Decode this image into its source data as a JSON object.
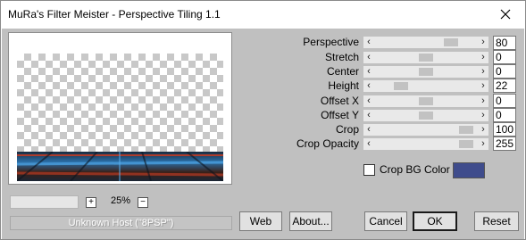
{
  "window": {
    "title": "MuRa's Filter Meister - Perspective Tiling 1.1"
  },
  "zoom": {
    "plus": "+",
    "minus": "−",
    "value": "25%"
  },
  "status": {
    "host": "Unknown Host (\"8PSP\")",
    "progress_percent": 0
  },
  "params": [
    {
      "label": "Perspective",
      "value": "80",
      "position_fraction": 0.78
    },
    {
      "label": "Stretch",
      "value": "0",
      "position_fraction": 0.5
    },
    {
      "label": "Center",
      "value": "0",
      "position_fraction": 0.5
    },
    {
      "label": "Height",
      "value": "22",
      "position_fraction": 0.22
    },
    {
      "label": "Offset X",
      "value": "0",
      "position_fraction": 0.5
    },
    {
      "label": "Offset Y",
      "value": "0",
      "position_fraction": 0.5
    },
    {
      "label": "Crop",
      "value": "100",
      "position_fraction": 0.95
    },
    {
      "label": "Crop Opacity",
      "value": "255",
      "position_fraction": 0.95
    }
  ],
  "crop_bg": {
    "label": "Crop BG Color",
    "checked": false,
    "color": "#3f4c8c"
  },
  "buttons": {
    "web": "Web",
    "about": "About...",
    "cancel": "Cancel",
    "ok": "OK",
    "reset": "Reset"
  }
}
